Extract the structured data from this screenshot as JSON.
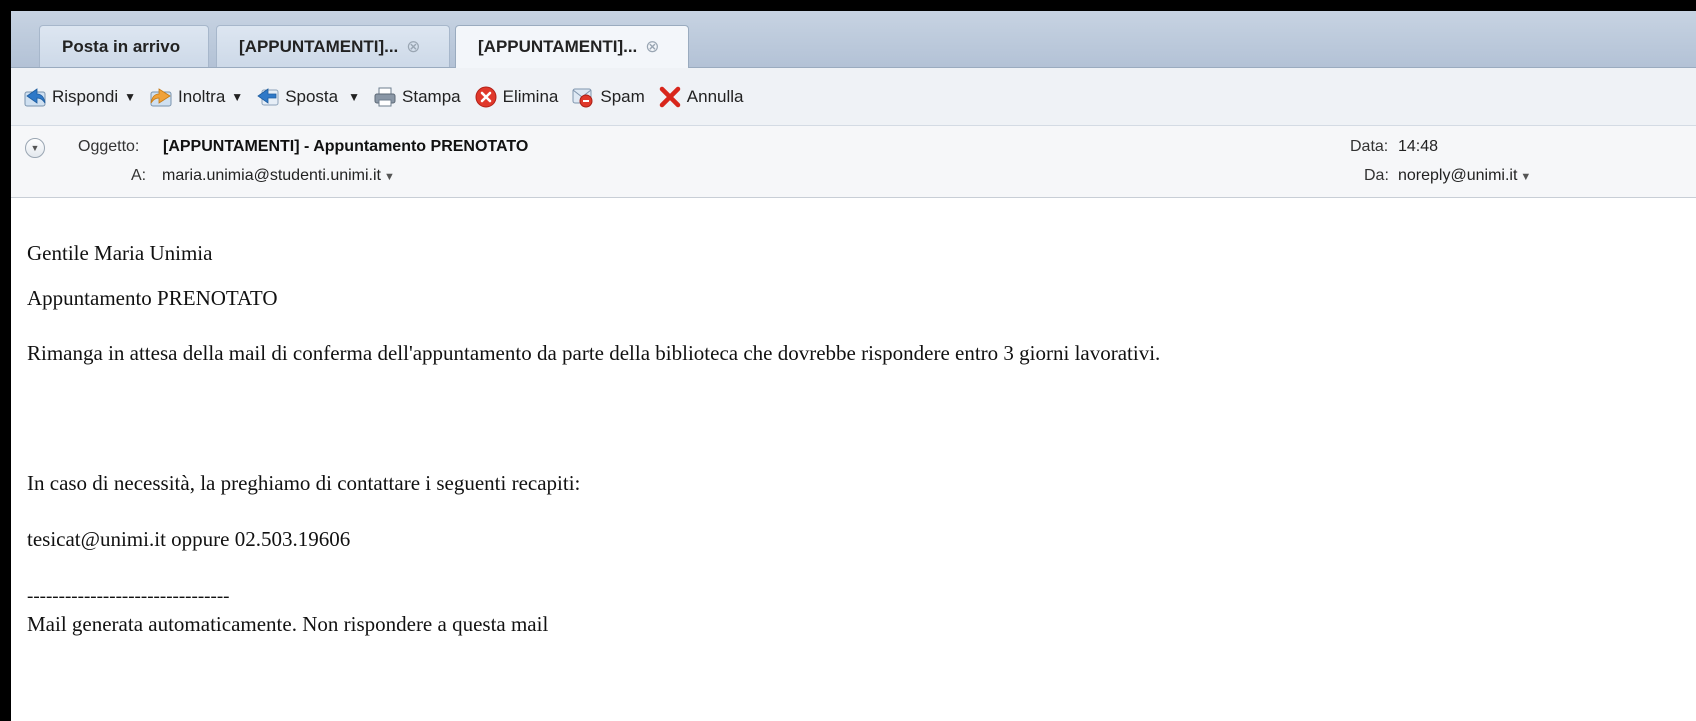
{
  "tabs": [
    {
      "label": "Posta in arrivo",
      "closable": false
    },
    {
      "label": "[APPUNTAMENTI]...",
      "closable": true
    },
    {
      "label": "[APPUNTAMENTI]...",
      "closable": true,
      "active": true
    }
  ],
  "toolbar": {
    "reply": "Rispondi",
    "forward": "Inoltra",
    "move": "Sposta",
    "print": "Stampa",
    "delete": "Elimina",
    "spam": "Spam",
    "cancel": "Annulla"
  },
  "header": {
    "subject_label": "Oggetto:",
    "subject": "[APPUNTAMENTI] - Appuntamento PRENOTATO",
    "to_label": "A:",
    "to": "maria.unimia@studenti.unimi.it",
    "date_label": "Data:",
    "date": "14:48",
    "from_label": "Da:",
    "from": "noreply@unimi.it"
  },
  "body": {
    "greeting": "Gentile Maria Unimia",
    "status": "Appuntamento PRENOTATO",
    "wait_text": "Rimanga in attesa della mail di conferma dell'appuntamento da parte della biblioteca che dovrebbe rispondere entro 3 giorni lavorativi.",
    "contact_intro": "In caso di necessità, la preghiamo di contattare i seguenti recapiti:",
    "contacts": "tesicat@unimi.it oppure 02.503.19606",
    "separator": "--------------------------------",
    "footer": "Mail generata automaticamente. Non rispondere a questa mail"
  },
  "colors": {
    "tabbar_bg": "#b3c2d6",
    "toolbar_bg": "#eff2f6",
    "header_bg": "#f6f7f9",
    "delete_red": "#e0382b",
    "annulla_red": "#d8261c"
  },
  "icons": {
    "reply": "reply-arrow-icon",
    "forward": "forward-arrow-icon",
    "move": "move-arrow-icon",
    "print": "printer-icon",
    "delete": "red-x-circle-icon",
    "spam": "spam-icon",
    "cancel": "red-x-icon"
  }
}
